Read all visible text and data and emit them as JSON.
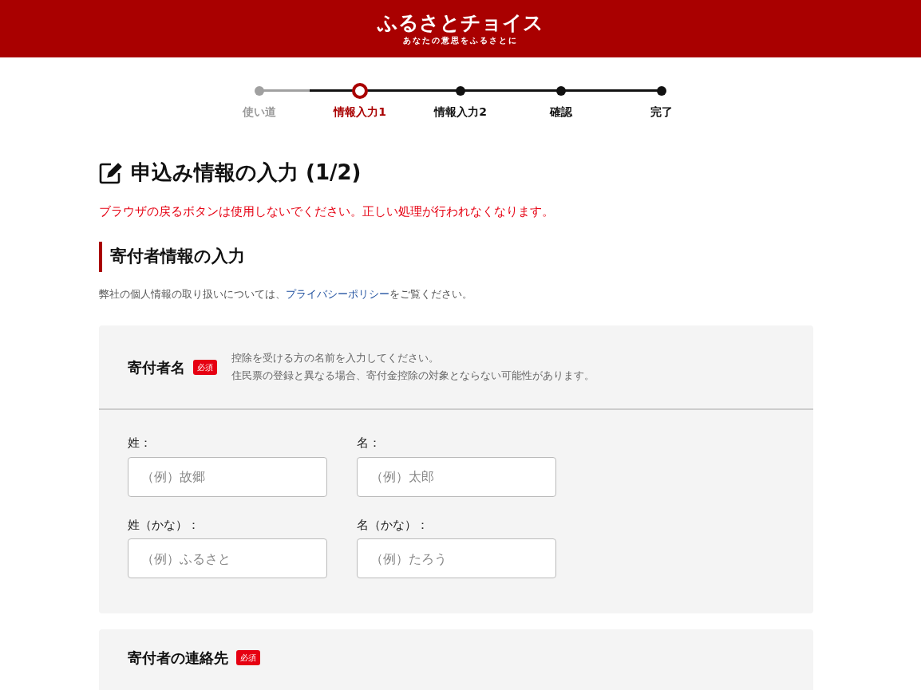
{
  "header": {
    "logo": "ふるさとチョイス",
    "tagline": "あなたの意思をふるさとに"
  },
  "steps": [
    {
      "label": "使い道",
      "kind": "done"
    },
    {
      "label": "情報入力1",
      "kind": "current"
    },
    {
      "label": "情報入力2",
      "kind": "upcoming"
    },
    {
      "label": "確認",
      "kind": "upcoming"
    },
    {
      "label": "完了",
      "kind": "upcoming"
    }
  ],
  "title": "申込み情報の入力 (1/2)",
  "warning": "ブラウザの戻るボタンは使用しないでください。正しい処理が行われなくなります。",
  "section": {
    "heading": "寄付者情報の入力",
    "note_before": "弊社の個人情報の取り扱いについては、",
    "note_link": "プライバシーポリシー",
    "note_after": "をご覧ください。"
  },
  "cards": [
    {
      "title": "寄付者名",
      "badge": "必須",
      "help": [
        "控除を受ける方の名前を入力してください。",
        "住民票の登録と異なる場合、寄付金控除の対象とならない可能性があります。"
      ],
      "fields": [
        {
          "label": "姓：",
          "placeholder": "（例）故郷"
        },
        {
          "label": "名：",
          "placeholder": "（例）太郎"
        },
        {
          "label": "姓（かな）：",
          "placeholder": "（例）ふるさと"
        },
        {
          "label": "名（かな）：",
          "placeholder": "（例）たろう"
        }
      ]
    },
    {
      "title": "寄付者の連絡先",
      "badge": "必須"
    }
  ]
}
